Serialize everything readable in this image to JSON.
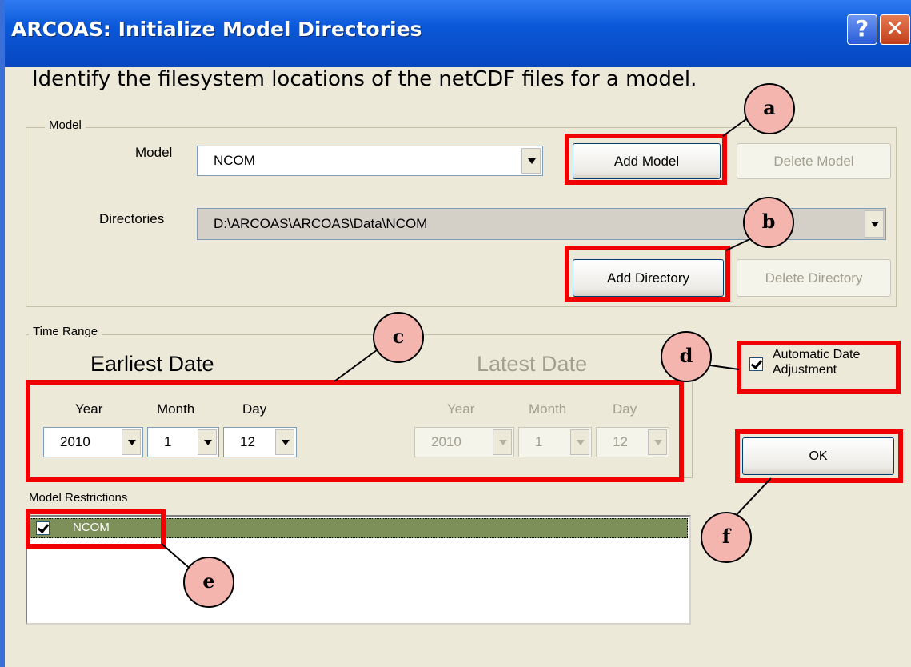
{
  "window": {
    "title": "ARCOAS:  Initialize Model Directories",
    "help_label": "?",
    "close_label": "✕"
  },
  "heading": "Identify the filesystem locations of the netCDF files for a model.",
  "model_group": {
    "legend": "Model",
    "model_label": "Model",
    "model_value": "NCOM",
    "add_model": "Add Model",
    "delete_model": "Delete Model",
    "directories_label": "Directories",
    "directories_value": "D:\\ARCOAS\\ARCOAS\\Data\\NCOM",
    "add_directory": "Add Directory",
    "delete_directory": "Delete Directory"
  },
  "time_range": {
    "legend": "Time Range",
    "earliest_title": "Earliest Date",
    "latest_title": "Latest Date",
    "year_label": "Year",
    "month_label": "Month",
    "day_label": "Day",
    "earliest": {
      "year": "2010",
      "month": "1",
      "day": "12"
    },
    "latest": {
      "year": "2010",
      "month": "1",
      "day": "12"
    }
  },
  "auto_date": {
    "label_line1": "Automatic Date",
    "label_line2": "Adjustment",
    "checked": true
  },
  "ok_label": "OK",
  "restrictions": {
    "label": "Model Restrictions",
    "items": [
      {
        "label": "NCOM",
        "checked": true
      }
    ]
  },
  "callouts": {
    "a": "a",
    "b": "b",
    "c": "c",
    "d": "d",
    "e": "e",
    "f": "f"
  },
  "colors": {
    "title_bar": "#0A58D8",
    "dialog_bg": "#ECE9D8",
    "highlight_red": "#F00000",
    "callout_fill": "#F5B5AF",
    "list_selection": "#7D9059"
  }
}
